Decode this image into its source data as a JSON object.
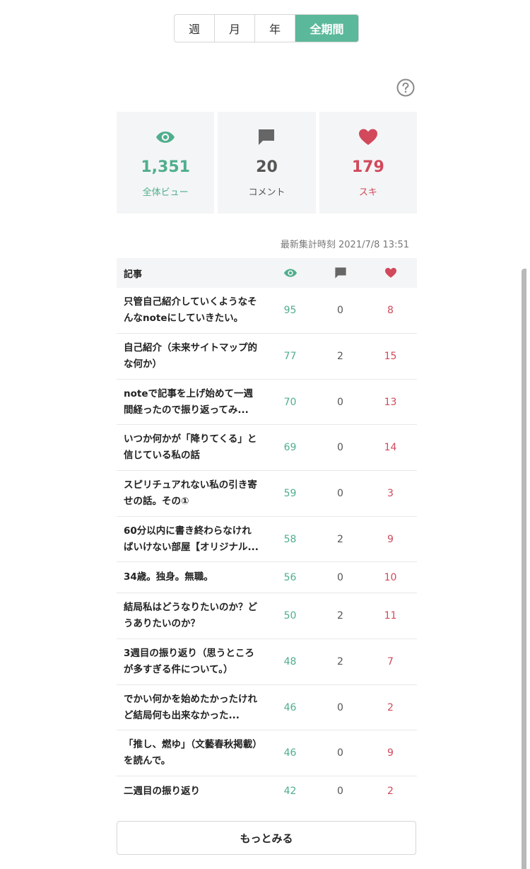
{
  "period_tabs": [
    {
      "label": "週",
      "active": false
    },
    {
      "label": "月",
      "active": false
    },
    {
      "label": "年",
      "active": false
    },
    {
      "label": "全期間",
      "active": true
    }
  ],
  "summary": {
    "views": {
      "value": "1,351",
      "label": "全体ビュー",
      "icon": "eye-icon"
    },
    "comments": {
      "value": "20",
      "label": "コメント",
      "icon": "comment-icon"
    },
    "likes": {
      "value": "179",
      "label": "スキ",
      "icon": "heart-icon"
    }
  },
  "updated_at": "最新集計時刻 2021/7/8 13:51",
  "table": {
    "header_title": "記事",
    "rows": [
      {
        "title": "只管自己紹介していくようなそんなnoteにしていきたい。",
        "views": "95",
        "comments": "0",
        "likes": "8"
      },
      {
        "title": "自己紹介（未来サイトマップ的な何か）",
        "views": "77",
        "comments": "2",
        "likes": "15"
      },
      {
        "title": "noteで記事を上げ始めて一週間経ったので振り返ってみ...",
        "views": "70",
        "comments": "0",
        "likes": "13"
      },
      {
        "title": "いつか何かが「降りてくる」と信じている私の話",
        "views": "69",
        "comments": "0",
        "likes": "14"
      },
      {
        "title": "スピリチュアれない私の引き寄せの話。その①",
        "views": "59",
        "comments": "0",
        "likes": "3"
      },
      {
        "title": "60分以内に書き終わらなければいけない部屋【オリジナル...",
        "views": "58",
        "comments": "2",
        "likes": "9"
      },
      {
        "title": "34歳。独身。無職。",
        "views": "56",
        "comments": "0",
        "likes": "10"
      },
      {
        "title": "結局私はどうなりたいのか？どうありたいのか？",
        "views": "50",
        "comments": "2",
        "likes": "11"
      },
      {
        "title": "3週目の振り返り（思うところが多すぎる件について。）",
        "views": "48",
        "comments": "2",
        "likes": "7"
      },
      {
        "title": "でかい何かを始めたかったけれど結局何も出来なかった...",
        "views": "46",
        "comments": "0",
        "likes": "2"
      },
      {
        "title": "「推し、燃ゆ」（文藝春秋掲載）を読んで。",
        "views": "46",
        "comments": "0",
        "likes": "9"
      },
      {
        "title": "二週目の振り返り",
        "views": "42",
        "comments": "0",
        "likes": "2"
      }
    ]
  },
  "more_button_label": "もっとみる",
  "colors": {
    "accent_green": "#5cb89a",
    "view_green": "#4fae8d",
    "like_red": "#d1495b",
    "comment_gray": "#555555"
  }
}
